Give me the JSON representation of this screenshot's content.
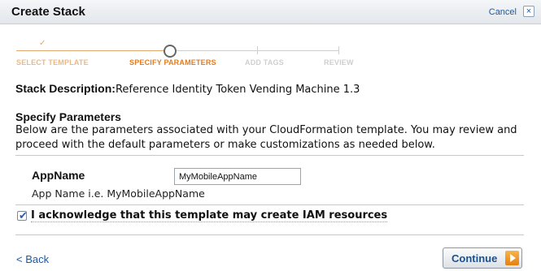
{
  "header": {
    "title": "Create Stack",
    "cancel_label": "Cancel",
    "close_icon": "close-icon",
    "close_glyph": "×"
  },
  "wizard": {
    "steps": [
      {
        "label": "SELECT TEMPLATE",
        "state": "done"
      },
      {
        "label": "SPECIFY PARAMETERS",
        "state": "current"
      },
      {
        "label": "ADD TAGS",
        "state": "todo"
      },
      {
        "label": "REVIEW",
        "state": "todo"
      }
    ],
    "done_mark": "✓",
    "colors": {
      "done": "#e8b98a",
      "current": "#e07b22",
      "todo": "#cfcfcf"
    }
  },
  "stack": {
    "description_label": "Stack Description:",
    "description_value": "Reference Identity Token Vending Machine 1.3"
  },
  "parameters": {
    "title": "Specify Parameters",
    "intro": "Below are the parameters associated with your CloudFormation template. You may review and proceed with the default parameters or make customizations as needed below.",
    "items": [
      {
        "name": "AppName",
        "value": "MyMobileAppName",
        "help": "App Name i.e. MyMobileAppName"
      }
    ]
  },
  "acknowledge": {
    "checked": true,
    "check_glyph": "✔",
    "label": "I acknowledge that this template may create IAM resources"
  },
  "footer": {
    "back_label": "< Back",
    "continue_label": "Continue",
    "continue_icon": "arrow-right-icon"
  }
}
